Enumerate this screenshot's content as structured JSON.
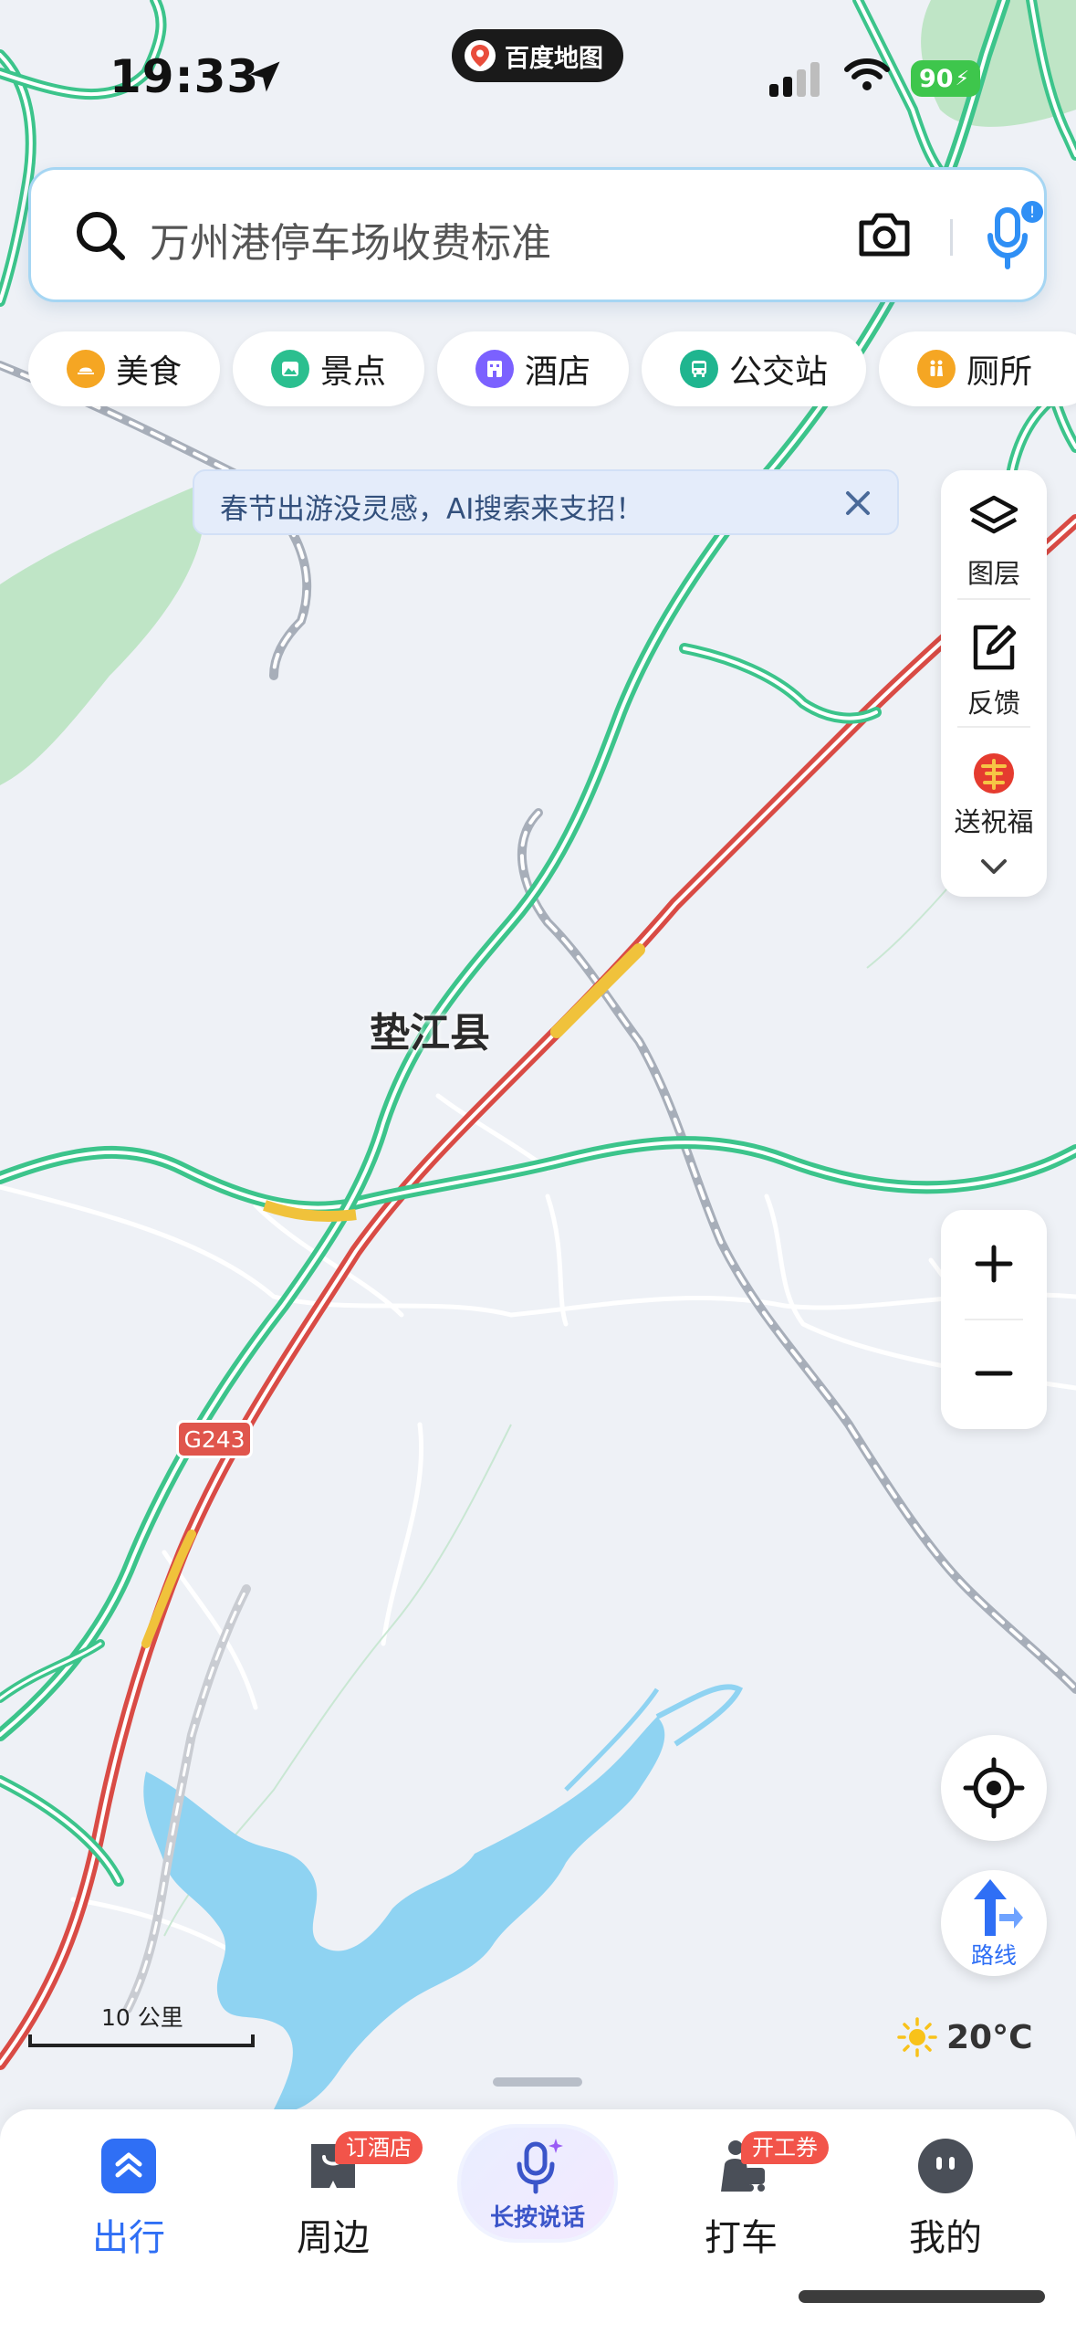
{
  "status_bar": {
    "time": "19:33",
    "app_name": "百度地图",
    "battery": "90"
  },
  "search": {
    "placeholder": "万州港停车场收费标准"
  },
  "categories": [
    {
      "label": "美食",
      "color": "#f5a623"
    },
    {
      "label": "景点",
      "color": "#2bbf8f"
    },
    {
      "label": "酒店",
      "color": "#7b61ff"
    },
    {
      "label": "公交站",
      "color": "#1fb58f"
    },
    {
      "label": "厕所",
      "color": "#f5a623"
    }
  ],
  "ai_banner": {
    "text": "春节出游没灵感，AI搜索来支招！"
  },
  "toolbox": {
    "layers": "图层",
    "feedback": "反馈",
    "blessing": "送祝福"
  },
  "map": {
    "city": "垫江县",
    "road": "G243",
    "scale": "10 公里",
    "weather": "20°C"
  },
  "route": {
    "label": "路线"
  },
  "nav": {
    "trip": "出行",
    "nearby": "周边",
    "nearby_badge": "订酒店",
    "voice": "长按说话",
    "taxi": "打车",
    "taxi_badge": "开工券",
    "mine": "我的"
  },
  "colors": {
    "accent": "#2f6ff5",
    "highway": "#3cc48b",
    "congestion": "#d94b45",
    "water": "#8fd3f2",
    "forest": "#b9e2c0"
  }
}
